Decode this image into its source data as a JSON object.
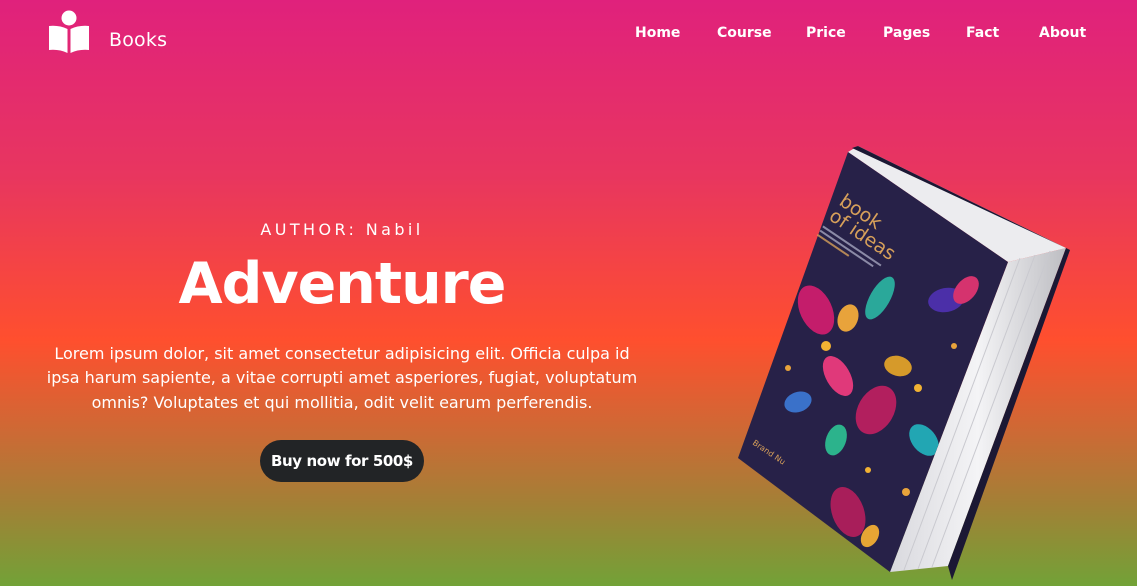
{
  "brand": {
    "name": "Books",
    "icon": "book-reader-icon"
  },
  "nav": {
    "items": [
      {
        "label": "Home"
      },
      {
        "label": "Course"
      },
      {
        "label": "Price"
      },
      {
        "label": "Pages"
      },
      {
        "label": "Fact"
      },
      {
        "label": "About"
      }
    ]
  },
  "hero": {
    "author": "AUTHOR: Nabil",
    "title": "Adventure",
    "description": "Lorem ipsum dolor, sit amet consectetur adipisicing elit. Officia culpa id ipsa harum sapiente, a vitae corrupti amet asperiores, fugiat, voluptatum omnis? Voluptates et qui mollitia, odit velit earum perferendis.",
    "button_label": "Buy now for 500$"
  },
  "book": {
    "cover_title_line1": "book",
    "cover_title_line2": "of ideas",
    "publisher": "Brand Nu"
  },
  "colors": {
    "gradient_top": "#e0217c",
    "gradient_mid": "#ff4f2e",
    "gradient_bottom": "#72a237",
    "button_bg": "#222426",
    "book_cover": "#272148"
  }
}
